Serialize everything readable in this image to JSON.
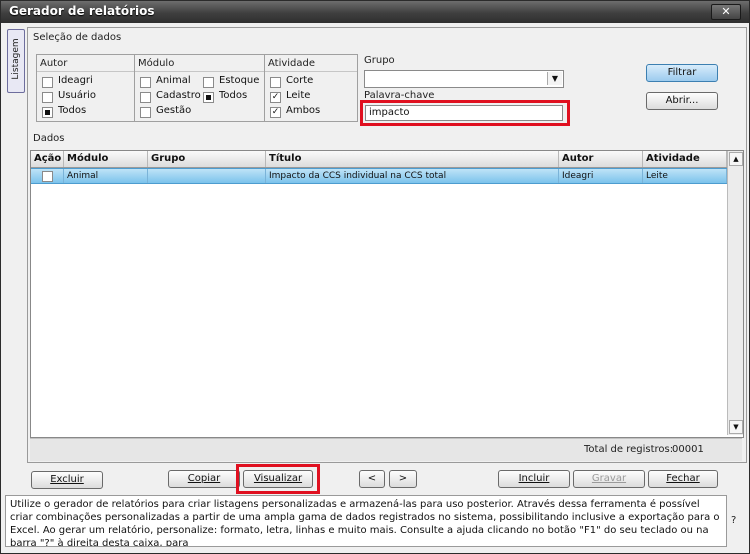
{
  "window": {
    "title": "Gerador de relatórios",
    "close_glyph": "✕"
  },
  "side_tab": {
    "label": "Listagem"
  },
  "selecao": {
    "title": "Seleção de dados",
    "autor": {
      "title": "Autor",
      "options": [
        "Ideagri",
        "Usuário",
        "Todos"
      ],
      "selected": "Todos"
    },
    "modulo": {
      "title": "Módulo",
      "options": [
        "Animal",
        "Cadastro",
        "Gestão",
        "Estoque",
        "Todos"
      ],
      "selected": "Todos"
    },
    "atividade": {
      "title": "Atividade",
      "options": [
        "Corte",
        "Leite",
        "Ambos"
      ],
      "checked": [
        "Leite",
        "Ambos"
      ]
    },
    "grupo": {
      "label": "Grupo",
      "value": ""
    },
    "palavra_chave": {
      "label": "Palavra-chave",
      "value": "impacto"
    }
  },
  "buttons": {
    "filtrar": "Filtrar",
    "abrir": "Abrir..."
  },
  "dados": {
    "title": "Dados",
    "columns": [
      "Ação",
      "Módulo",
      "Grupo",
      "Título",
      "Autor",
      "Atividade"
    ],
    "rows": [
      {
        "acao": "",
        "modulo": "Animal",
        "grupo": "",
        "titulo": "Impacto da CCS individual na CCS total",
        "autor": "Ideagri",
        "atividade": "Leite"
      }
    ],
    "total_label": "Total de registros:",
    "total_value": "00001"
  },
  "actions": {
    "excluir": "Excluir",
    "copiar": "Copiar",
    "visualizar": "Visualizar",
    "prev": "<",
    "next": ">",
    "incluir": "Incluir",
    "gravar": "Gravar",
    "fechar": "Fechar"
  },
  "help": {
    "text": "Utilize o gerador de relatórios para criar listagens personalizadas e armazená-las para uso posterior. Através dessa ferramenta é possível criar combinações personalizadas a partir de uma ampla gama de dados registrados no sistema, possibilitando inclusive a exportação para o Excel. Ao gerar um relatório, personalize: formato, letra, linhas e muito mais. Consulte a ajuda clicando no botão \"F1\" do seu teclado ou na barra \"?\" à direita desta caixa, para",
    "question": "?"
  },
  "colors": {
    "highlight": "#e01020",
    "row_selected": "#7cc3ec",
    "button_primary": "#9ccbee"
  }
}
